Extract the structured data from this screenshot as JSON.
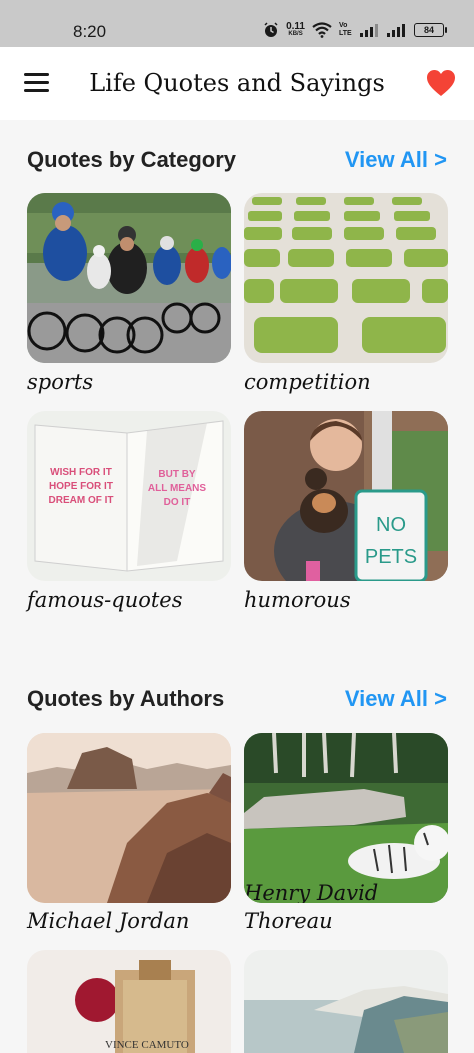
{
  "status_bar": {
    "time": "8:20",
    "net_speed_value": "0.11",
    "net_speed_unit": "KB/S",
    "volte": "Vo LTE",
    "battery": "84"
  },
  "app_bar": {
    "title": "Life Quotes and Sayings",
    "menu_icon": "hamburger-menu-icon",
    "favorite_icon": "heart-icon",
    "accent_color": "#f44336"
  },
  "category_section": {
    "title": "Quotes by Category",
    "view_all": "View All >",
    "items": [
      {
        "label": "sports"
      },
      {
        "label": "competition"
      },
      {
        "label": "famous-quotes"
      },
      {
        "label": "humorous"
      }
    ]
  },
  "author_section": {
    "title": "Quotes by Authors",
    "view_all": "View All >",
    "items": [
      {
        "label": "Michael Jordan"
      },
      {
        "label_line1": "Henry David",
        "label_line2": "Thoreau"
      },
      {
        "label": ""
      },
      {
        "label": ""
      }
    ]
  },
  "image_text": {
    "book_left": "WISH FOR IT\nHOPE FOR IT\nDREAM OF IT",
    "book_right": "BUT BY\nALL MEANS\nDO IT",
    "sign_line1": "NO",
    "sign_line2": "PETS",
    "perfume_text": "VINCE CAMUTO"
  },
  "link_color": "#2196f3"
}
